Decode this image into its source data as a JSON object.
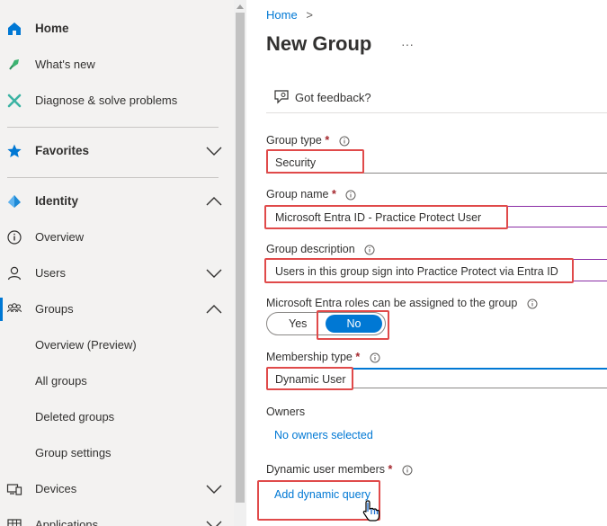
{
  "sidebar": {
    "items": [
      {
        "label": "Home",
        "icon": "home-icon"
      },
      {
        "label": "What's new",
        "icon": "rocket-icon"
      },
      {
        "label": "Diagnose & solve problems",
        "icon": "wrench-icon"
      },
      {
        "label": "Favorites",
        "icon": "star-icon"
      },
      {
        "label": "Identity",
        "icon": "diamond-icon"
      },
      {
        "label": "Overview",
        "icon": "info-circle-icon"
      },
      {
        "label": "Users",
        "icon": "user-icon"
      },
      {
        "label": "Groups",
        "icon": "groups-icon"
      },
      {
        "label": "Overview (Preview)"
      },
      {
        "label": "All groups"
      },
      {
        "label": "Deleted groups"
      },
      {
        "label": "Group settings"
      },
      {
        "label": "Devices",
        "icon": "devices-icon"
      },
      {
        "label": "Applications",
        "icon": "apps-icon"
      }
    ]
  },
  "breadcrumb": {
    "home": "Home",
    "separator": ">"
  },
  "page": {
    "title": "New Group",
    "more": "···"
  },
  "feedback": {
    "label": "Got feedback?"
  },
  "form": {
    "group_type": {
      "label": "Group type",
      "required": "*",
      "value": "Security"
    },
    "group_name": {
      "label": "Group name",
      "required": "*",
      "value": "Microsoft Entra ID - Practice Protect User"
    },
    "group_description": {
      "label": "Group description",
      "value": "Users in this group sign into Practice Protect via Entra ID"
    },
    "roles": {
      "label": "Microsoft Entra roles can be assigned to the group",
      "yes": "Yes",
      "no": "No",
      "selected": "No"
    },
    "membership_type": {
      "label": "Membership type",
      "required": "*",
      "value": "Dynamic User"
    },
    "owners": {
      "label": "Owners",
      "value": "No owners selected"
    },
    "dynamic_members": {
      "label": "Dynamic user members",
      "required": "*",
      "action": "Add dynamic query"
    }
  },
  "colors": {
    "accent": "#0078d4",
    "highlight_box": "#e04a4a",
    "field_underline": "#8a2da5"
  }
}
